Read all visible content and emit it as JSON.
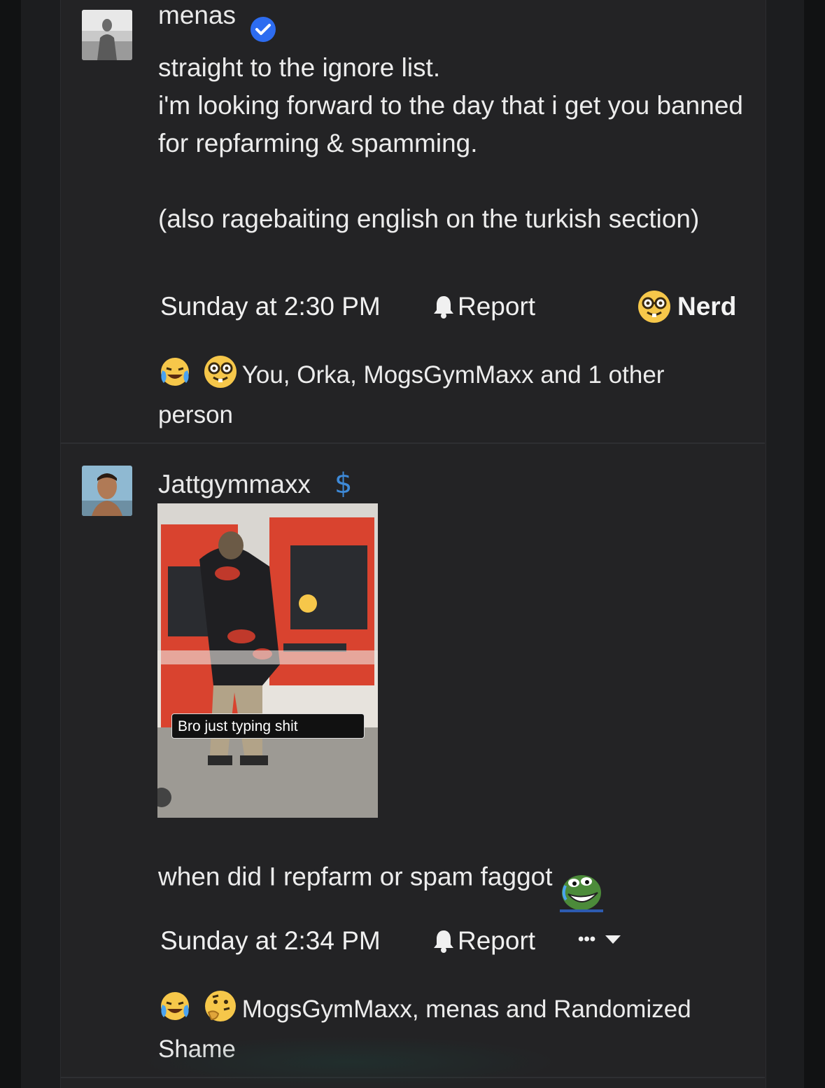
{
  "posts": [
    {
      "username": "menas",
      "verified": true,
      "body": "straight to the ignore list.\ni'm looking forward to the day that i get you banned for repfarming & spamming.\n\n(also ragebaiting english on the turkish section)",
      "timestamp": "Sunday at 2:30 PM",
      "report_label": "Report",
      "reaction_button": "Nerd",
      "reactions_text": "You, Orka, MogsGymMaxx and 1 other person",
      "reaction_icons": [
        "crying-laughing-emoji",
        "nerd-emoji"
      ]
    },
    {
      "username": "Jattgymmaxx",
      "badge": "$",
      "media_caption": "Bro just typing shit",
      "body": "when did I repfarm or spam faggot",
      "timestamp": "Sunday at 2:34 PM",
      "report_label": "Report",
      "more_label": "•••",
      "reactions_text": "MogsGymMaxx, menas and Randomized Shame",
      "reaction_icons": [
        "crying-laughing-emoji",
        "thinking-emoji"
      ]
    }
  ],
  "colors": {
    "username1": "#f3c14b",
    "username2": "#e44e7b",
    "verified": "#2d6cf0",
    "background": "#232325"
  }
}
